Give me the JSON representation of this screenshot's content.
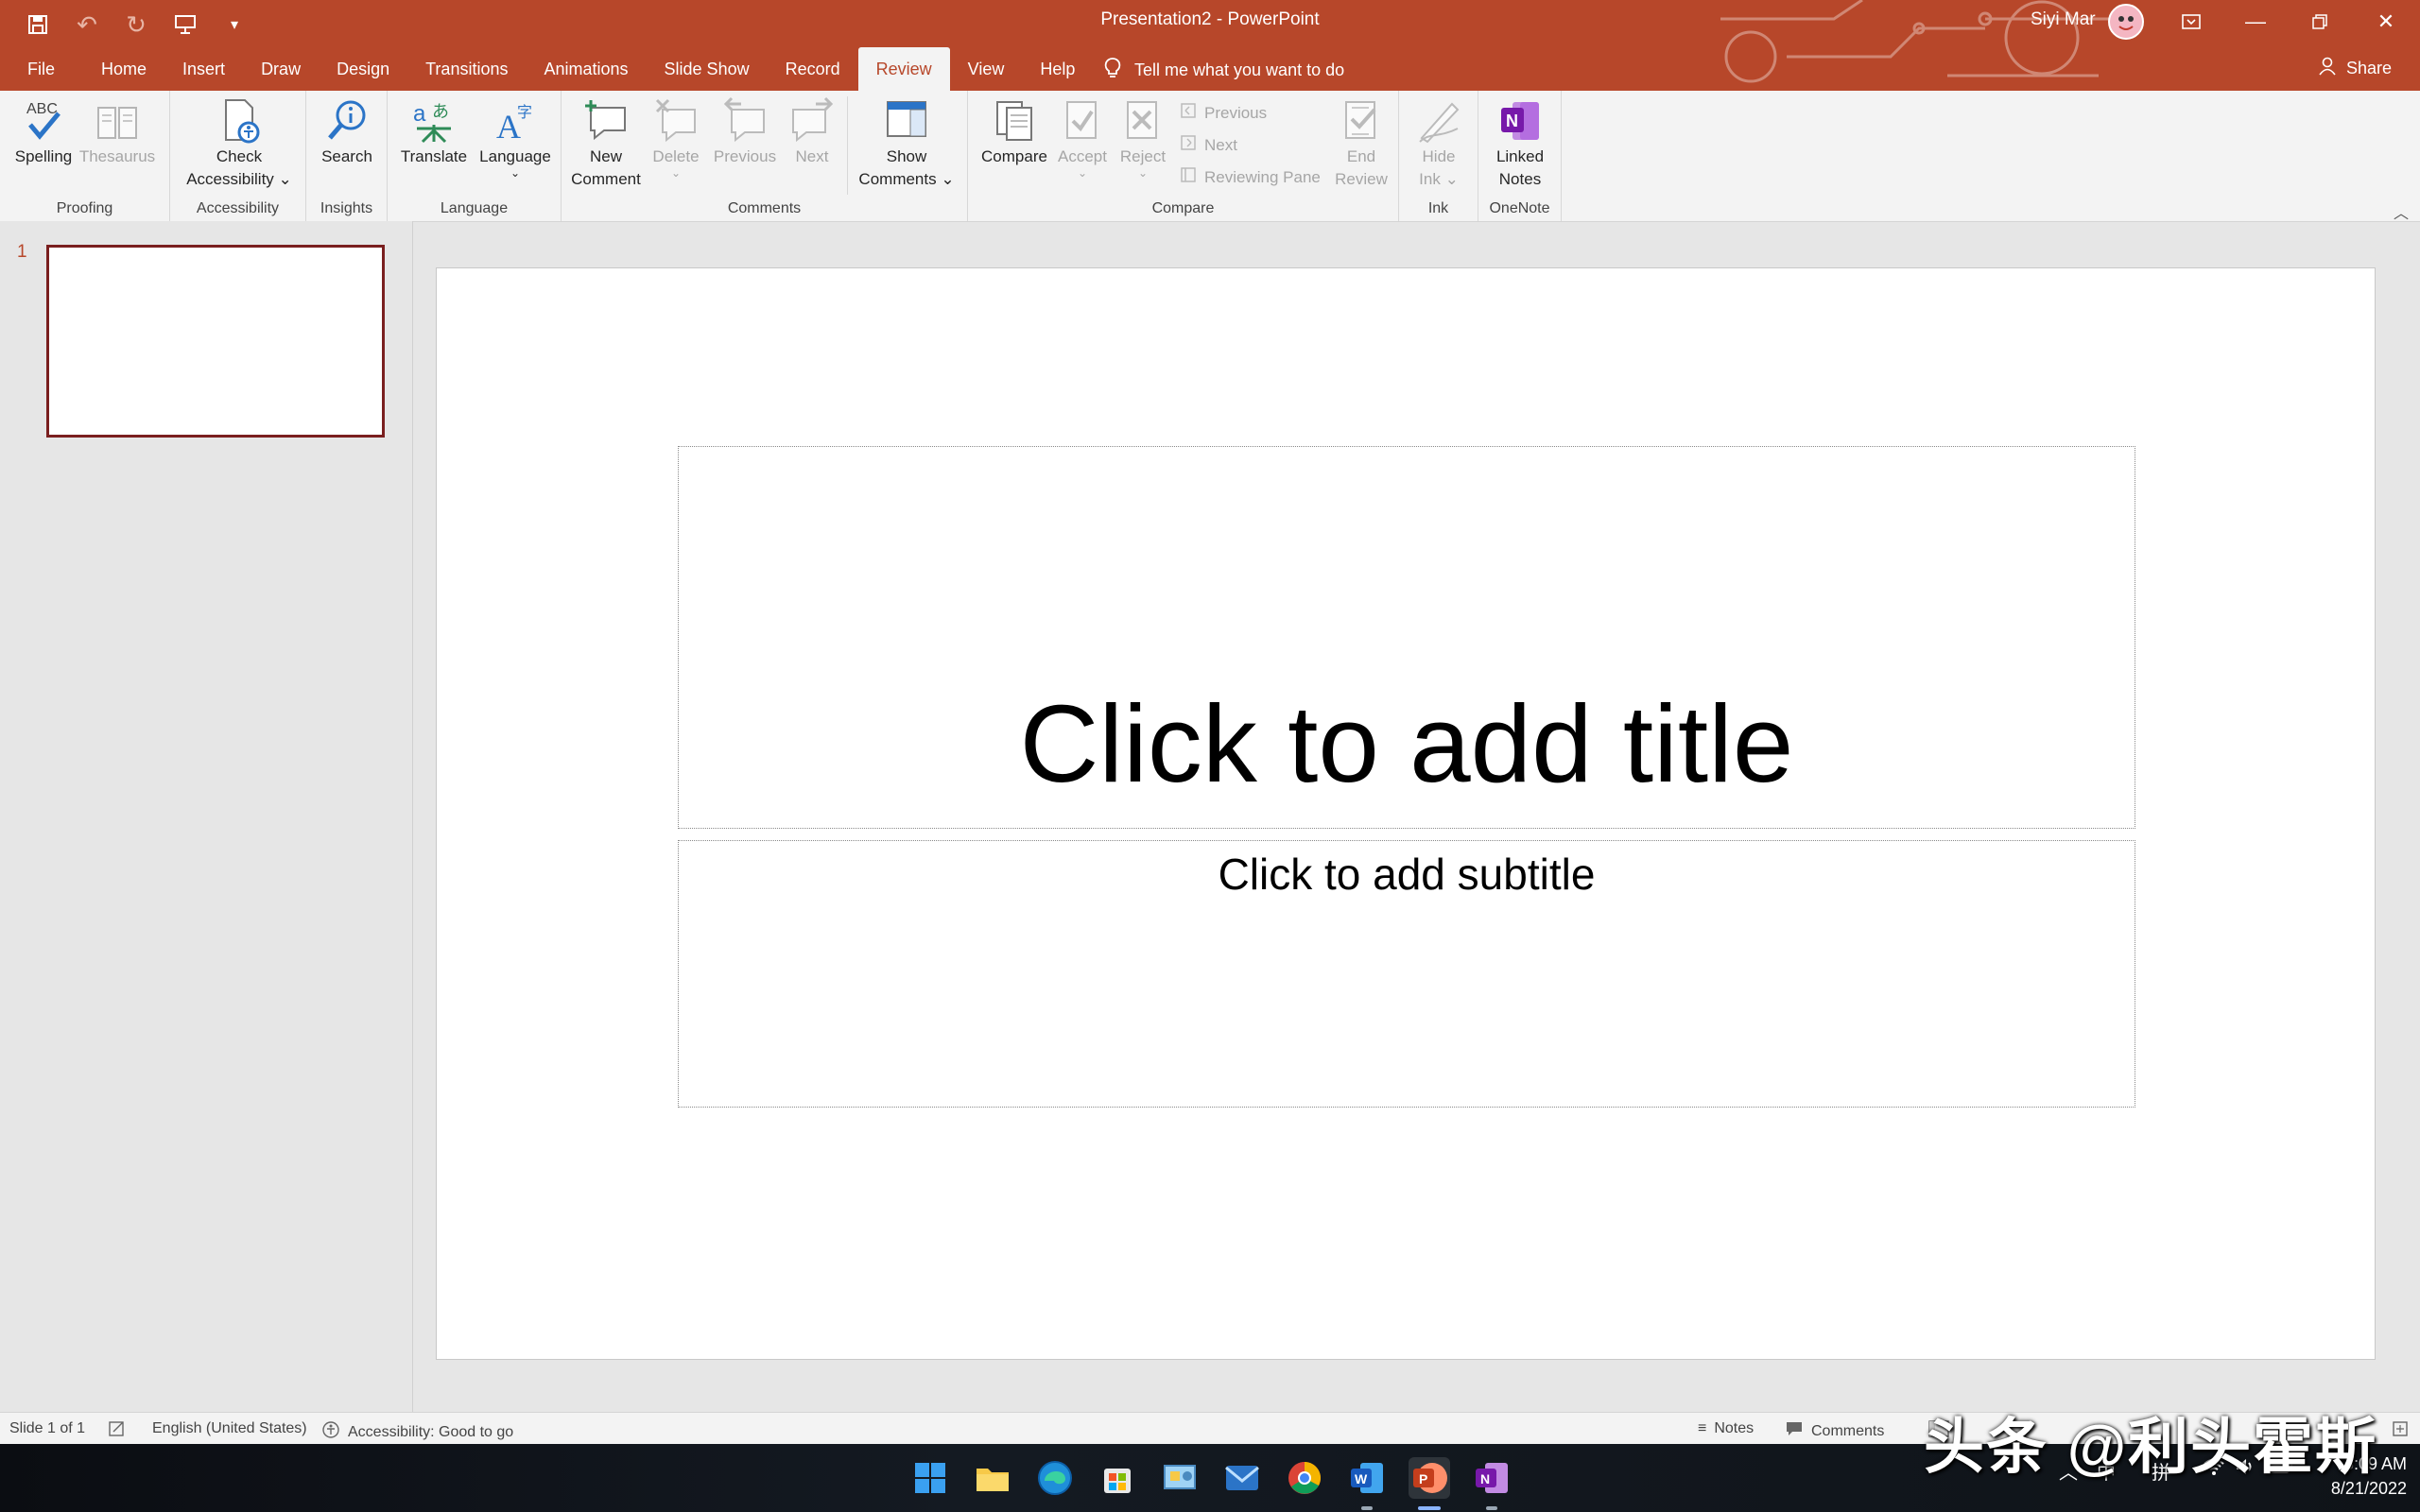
{
  "app": {
    "document_title": "Presentation2  -  PowerPoint",
    "user_name": "Siyi Mar"
  },
  "ribbon_tabs": [
    "File",
    "Home",
    "Insert",
    "Draw",
    "Design",
    "Transitions",
    "Animations",
    "Slide Show",
    "Record",
    "Review",
    "View",
    "Help"
  ],
  "active_tab": "Review",
  "tell_me": "Tell me what you want to do",
  "share_label": "Share",
  "groups": {
    "proofing": {
      "label": "Proofing",
      "spelling": "Spelling",
      "thesaurus": "Thesaurus",
      "abc": "ABC"
    },
    "accessibility": {
      "label": "Accessibility",
      "check_1": "Check",
      "check_2": "Accessibility"
    },
    "insights": {
      "label": "Insights",
      "search": "Search"
    },
    "language": {
      "label": "Language",
      "translate": "Translate",
      "language": "Language"
    },
    "comments": {
      "label": "Comments",
      "new_1": "New",
      "new_2": "Comment",
      "delete": "Delete",
      "previous": "Previous",
      "next": "Next",
      "show_1": "Show",
      "show_2": "Comments"
    },
    "compare": {
      "label": "Compare",
      "compare": "Compare",
      "accept": "Accept",
      "reject": "Reject",
      "previous": "Previous",
      "next": "Next",
      "reviewing_pane": "Reviewing Pane",
      "end_1": "End",
      "end_2": "Review"
    },
    "ink": {
      "label": "Ink",
      "hide_1": "Hide",
      "hide_2": "Ink"
    },
    "onenote": {
      "label": "OneNote",
      "linked_1": "Linked",
      "linked_2": "Notes"
    }
  },
  "thumbnails": {
    "slide_number": "1"
  },
  "slide": {
    "title_placeholder": "Click to add title",
    "subtitle_placeholder": "Click to add subtitle"
  },
  "status": {
    "slide_info": "Slide 1 of 1",
    "language": "English (United States)",
    "accessibility": "Accessibility: Good to go",
    "notes": "Notes",
    "comments": "Comments"
  },
  "taskbar": {
    "time": "3:09 AM",
    "date": "8/21/2022",
    "ime_1": "中",
    "ime_2": "拼"
  },
  "watermark": "头条 @利头霍斯",
  "colors": {
    "accent": "#b7472a",
    "ribbon": "#f3f3f3",
    "canvas": "#e6e6e6"
  }
}
